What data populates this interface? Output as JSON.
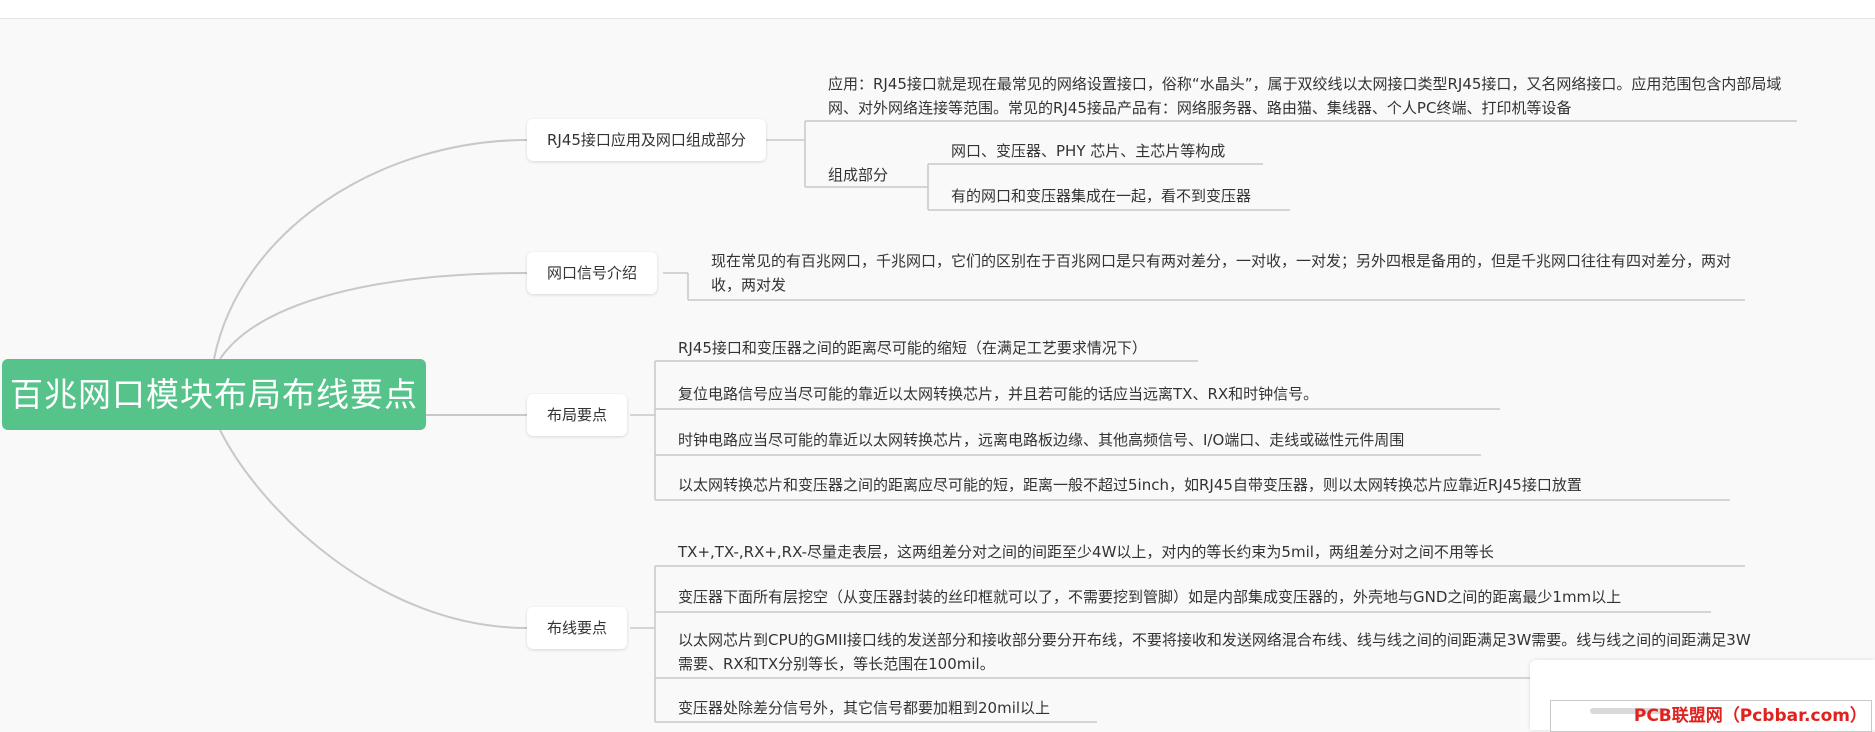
{
  "root": {
    "title": "百兆网口模块布局布线要点"
  },
  "branches": [
    {
      "label": "RJ45接口应用及网口组成部分",
      "application": "应用：RJ45接口就是现在最常见的网络设置接口，俗称“水晶头”，属于双绞线以太网接口类型RJ45接口，又名网络接口。应用范围包含内部局域网、对外网络连接等范围。常见的RJ45接品产品有：网络服务器、路由猫、集线器、个人PC终端、打印机等设备",
      "composition_label": "组成部分",
      "composition_items": [
        "网口、变压器、PHY 芯片、主芯片等构成",
        "有的网口和变压器集成在一起，看不到变压器"
      ]
    },
    {
      "label": "网口信号介绍",
      "items": [
        "现在常见的有百兆网口，千兆网口，它们的区别在于百兆网口是只有两对差分，一对收，一对发；另外四根是备用的，但是千兆网口往往有四对差分，两对收，两对发"
      ]
    },
    {
      "label": "布局要点",
      "items": [
        "RJ45接口和变压器之间的距离尽可能的缩短（在满足工艺要求情况下）",
        "复位电路信号应当尽可能的靠近以太网转换芯片，并且若可能的话应当远离TX、RX和时钟信号。",
        "时钟电路应当尽可能的靠近以太网转换芯片，远离电路板边缘、其他高频信号、I/O端口、走线或磁性元件周围",
        "以太网转换芯片和变压器之间的距离应尽可能的短，距离一般不超过5inch，如RJ45自带变压器，则以太网转换芯片应靠近RJ45接口放置"
      ]
    },
    {
      "label": "布线要点",
      "items": [
        "TX+,TX-,RX+,RX-尽量走表层，这两组差分对之间的间距至少4W以上，对内的等长约束为5mil，两组差分对之间不用等长",
        "变压器下面所有层挖空（从变压器封装的丝印框就可以了，不需要挖到管脚）如是内部集成变压器的，外壳地与GND之间的距离最少1mm以上",
        "以太网芯片到CPU的GMII接口线的发送部分和接收部分要分开布线，不要将接收和发送网络混合布线、线与线之间的间距满足3W需要。线与线之间的间距满足3W 需要、RX和TX分别等长，等长范围在100mil。",
        "变压器处除差分信号外，其它信号都要加粗到20mil以上"
      ]
    }
  ],
  "watermark": "PCB联盟网（Pcbbar.com）",
  "colors": {
    "root_bg": "#55c38a",
    "line": "#c8c8c8",
    "background": "#f9f9f9",
    "watermark": "#e0221e"
  }
}
